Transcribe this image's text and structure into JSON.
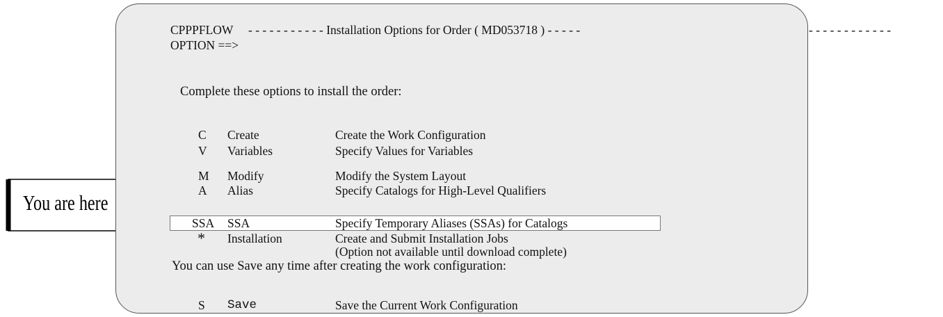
{
  "header": {
    "panel_id": "CPPPFLOW",
    "title": "- - - - - - - - - - - Installation Options for Order ( MD053718 ) - - - - -",
    "title_overflow": "- - - - - - - - - - - -",
    "option_prompt": "OPTION ==>"
  },
  "intro": "Complete these options to install the order:",
  "options": [
    {
      "code": "C",
      "name": "Create",
      "description": "Create the Work Configuration"
    },
    {
      "code": "V",
      "name": "Variables",
      "description": "Specify Values for Variables"
    },
    {
      "code": "M",
      "name": "Modify",
      "description": "Modify the System Layout"
    },
    {
      "code": "A",
      "name": "Alias",
      "description": "Specify Catalogs for High-Level Qualifiers"
    },
    {
      "code": "SSA",
      "name": "SSA",
      "description": "Specify Temporary Aliases (SSAs) for Catalogs"
    },
    {
      "code": "*",
      "name": "Installation",
      "description": "Create and Submit Installation Jobs",
      "note": "(Option not available until download complete)"
    }
  ],
  "save_intro": "You can use Save any time after creating the work configuration:",
  "save_option": {
    "code": "S",
    "name": "Save",
    "description": "Save the Current Work Configuration"
  },
  "callout": {
    "text": "You are here",
    "highlighted_option": "SSA"
  },
  "colors": {
    "panel_bg": "#ececec",
    "highlight_bg": "#ffffff",
    "text": "#111111"
  }
}
